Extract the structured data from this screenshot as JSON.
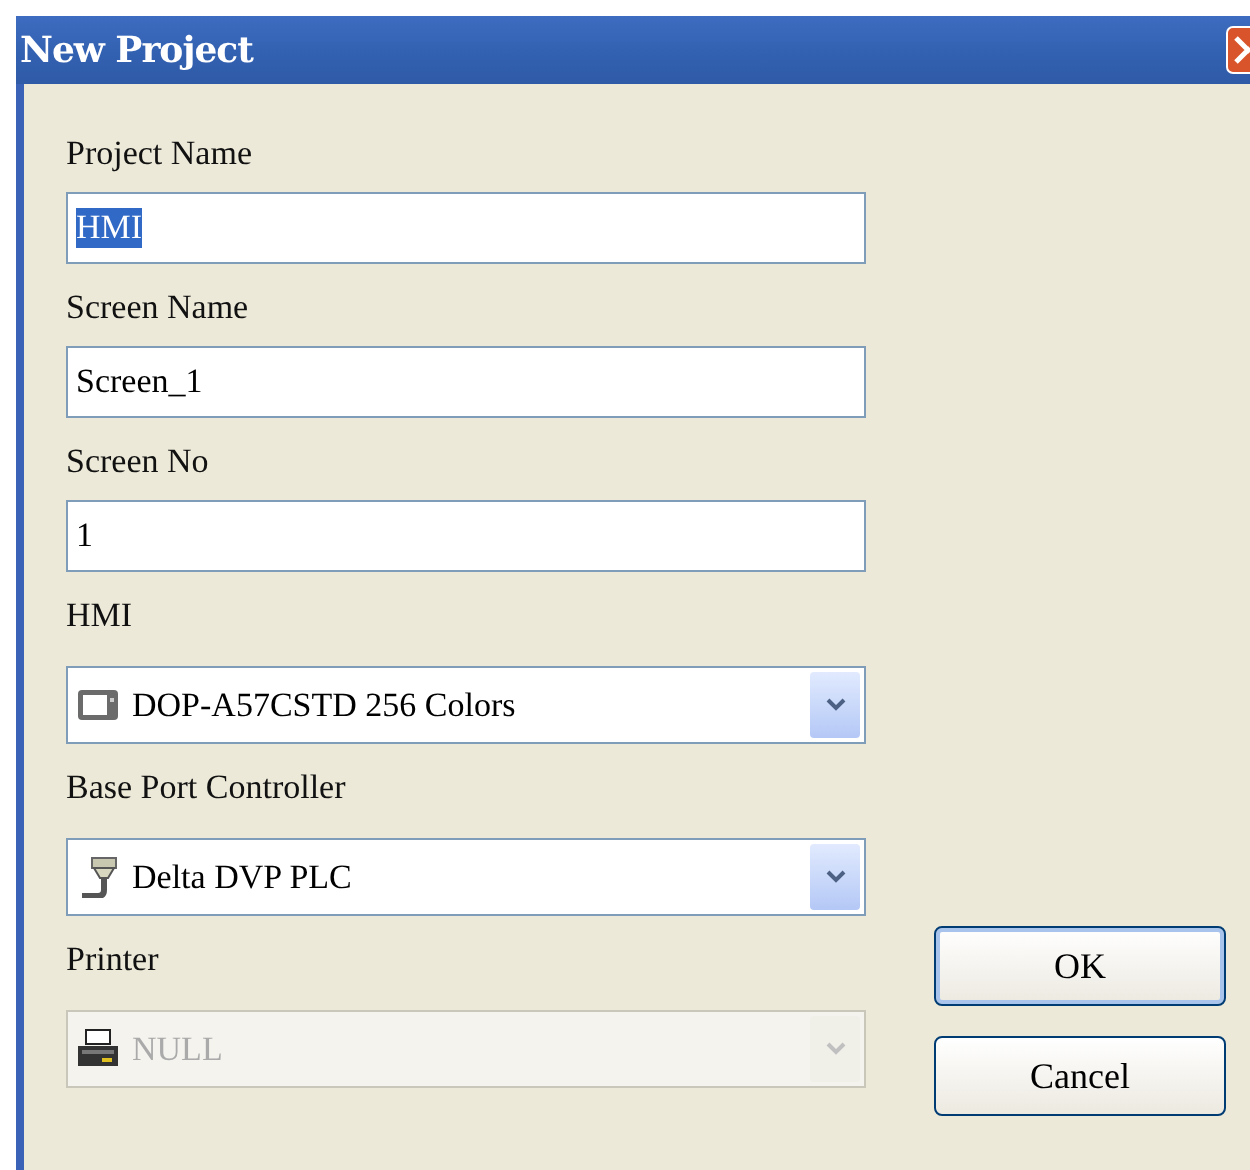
{
  "window": {
    "title": "New Project"
  },
  "fields": [
    {
      "kind": "text",
      "label": "Project Name",
      "value": "HMI",
      "text_selected": true,
      "disabled": false
    },
    {
      "kind": "text",
      "label": "Screen Name",
      "value": "Screen_1",
      "text_selected": false,
      "disabled": false
    },
    {
      "kind": "text",
      "label": "Screen No",
      "value": "1",
      "text_selected": false,
      "disabled": false
    },
    {
      "kind": "combo",
      "label": "HMI",
      "value": "DOP-A57CSTD 256 Colors",
      "disabled": false
    },
    {
      "kind": "combo",
      "label": "Base Port Controller",
      "value": "Delta DVP PLC",
      "disabled": false
    },
    {
      "kind": "combo",
      "label": "Printer",
      "value": "NULL",
      "disabled": true
    }
  ],
  "buttons": [
    {
      "label": "OK",
      "default": true
    },
    {
      "label": "Cancel",
      "default": false
    }
  ]
}
